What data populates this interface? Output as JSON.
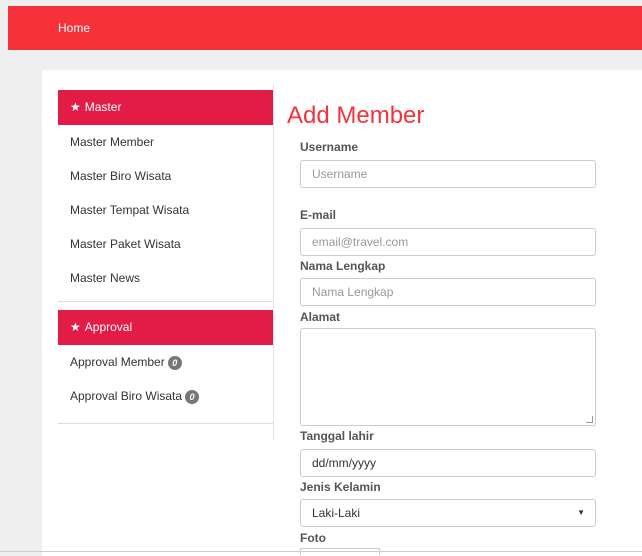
{
  "nav": {
    "home": "Home"
  },
  "sidebar": {
    "master": {
      "heading": "Master",
      "items": [
        "Master Member",
        "Master Biro Wisata",
        "Master Tempat Wisata",
        "Master Paket Wisata",
        "Master News"
      ]
    },
    "approval": {
      "heading": "Approval",
      "items": [
        {
          "label": "Approval Member",
          "count": "0"
        },
        {
          "label": "Approval Biro Wisata",
          "count": "0"
        }
      ]
    },
    "icons": {
      "heading_icon": "star-icon"
    }
  },
  "form": {
    "title": "Add Member",
    "username": {
      "label": "Username",
      "placeholder": "Username"
    },
    "email": {
      "label": "E-mail",
      "placeholder": "email@travel.com"
    },
    "nama": {
      "label": "Nama Lengkap",
      "placeholder": "Nama Lengkap"
    },
    "alamat": {
      "label": "Alamat"
    },
    "tanggal": {
      "label": "Tanggal lahir",
      "placeholder": "dd/mm/yyyy"
    },
    "gender": {
      "label": "Jenis Kelamin",
      "value": "Laki-Laki"
    },
    "foto": {
      "label": "Foto"
    }
  },
  "colors": {
    "navbar": "#f5323a",
    "sidebar_heading": "#e31b47",
    "title": "#f5323a",
    "badge": "#777777"
  }
}
